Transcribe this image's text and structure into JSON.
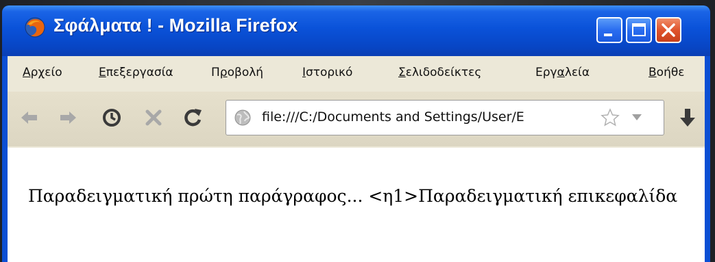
{
  "window": {
    "title": "Σφάλματα ! - Mozilla Firefox",
    "icon": "firefox-icon",
    "controls": [
      "minimize-icon",
      "maximize-icon",
      "close-icon"
    ]
  },
  "menu": [
    {
      "label": "Αρχείο",
      "accel": "Α",
      "rest": "ρχείο"
    },
    {
      "label": "Επεξεργασία",
      "accel": "Ε",
      "rest": "πεξεργασία"
    },
    {
      "label": "Προβολή",
      "pre": "Π",
      "accel": "ρ",
      "rest": "οβολή"
    },
    {
      "label": "Ιστορικό",
      "accel": "Ι",
      "rest": "στορικό"
    },
    {
      "label": "Σελιδοδείκτες",
      "accel": "Σ",
      "rest": "ελιδοδείκτες"
    },
    {
      "label": "Εργαλεία",
      "pre": "Εργ",
      "accel": "α",
      "rest": "λεία"
    },
    {
      "label": "Βοήθε",
      "accel": "Β",
      "rest": "οήθε"
    }
  ],
  "toolbar": {
    "buttons": [
      "back-arrow-icon",
      "forward-arrow-icon",
      "history-clock-icon",
      "stop-icon",
      "reload-icon"
    ],
    "url": "file:///C:/Documents and Settings/User/E",
    "bookmark_icon": "star-icon",
    "dropdown_icon": "chevron-down-icon",
    "download_icon": "download-arrow-icon"
  },
  "page": {
    "text": "Παραδειγματική πρώτη παράγραφος... <η1>Παραδειγματική επικεφαλίδα"
  },
  "colors": {
    "titlebar": "#0a52d9",
    "chrome": "#ece8d8",
    "close_button": "#e0542d",
    "content_bg": "#ffffff"
  }
}
